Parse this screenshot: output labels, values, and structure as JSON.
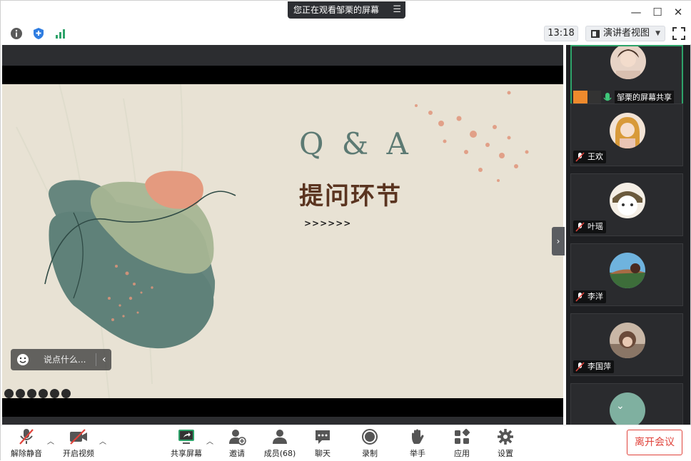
{
  "titlebar": {
    "share_notice": "您正在观看邹栗的屏幕"
  },
  "infobar": {
    "time": "13:18",
    "view_mode": "演讲者视图"
  },
  "slide": {
    "heading": "Q & A",
    "title": "提问环节",
    "arrows": ">>>>>>"
  },
  "chat": {
    "placeholder": "说点什么..."
  },
  "participants": [
    {
      "name": "邹栗的屏幕共享",
      "active": true
    },
    {
      "name": "王欢"
    },
    {
      "name": "叶瑶"
    },
    {
      "name": "李洋"
    },
    {
      "name": "李国萍"
    }
  ],
  "toolbar": {
    "unmute": "解除静音",
    "start_video": "开启视频",
    "share_screen": "共享屏幕",
    "invite": "邀请",
    "members": "成员(68)",
    "chat": "聊天",
    "record": "录制",
    "raise_hand": "举手",
    "apps": "应用",
    "settings": "设置",
    "leave": "离开会议"
  },
  "colors": {
    "accent_green": "#2ea36a",
    "leave_red": "#e0433b",
    "slide_bg": "#e8e2d4"
  }
}
